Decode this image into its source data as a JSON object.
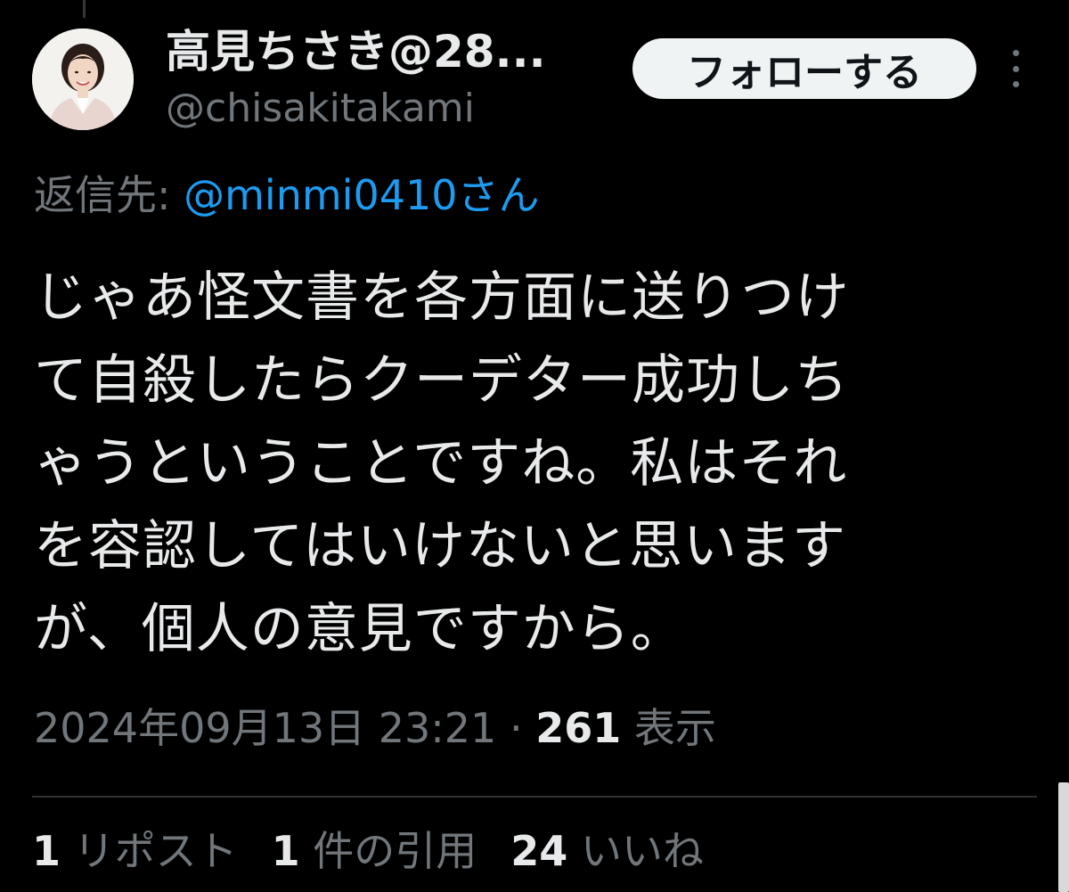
{
  "author": {
    "display_name": "高見ちさき@28...",
    "handle": "@chisakitakami"
  },
  "follow_button": {
    "label": "フォローする"
  },
  "reply_to": {
    "prefix": "返信先: ",
    "mention": "@minmi0410さん"
  },
  "tweet": {
    "lines": [
      "じゃあ怪文書を各方面に送りつけ",
      "て自殺したらクーデター成功しち",
      "ゃうということですね。私はそれ",
      "を容認してはいけないと思います",
      "が、個人の意見ですから。"
    ]
  },
  "meta": {
    "timestamp": "2024年09月13日 23:21",
    "separator": " · ",
    "views_count": "261",
    "views_label": " 表示"
  },
  "stats": {
    "reposts": {
      "count": "1",
      "label": " リポスト"
    },
    "quotes": {
      "count": "1",
      "label": " 件の引用"
    },
    "likes": {
      "count": "24",
      "label": " いいね"
    }
  },
  "icons": {
    "more": "more-dots-vertical-icon",
    "avatar": "profile-avatar"
  },
  "colors": {
    "background": "#000000",
    "text_primary": "#e7e9ea",
    "text_secondary": "#71767b",
    "link": "#1d9bf0",
    "button_bg": "#eff3f4",
    "divider": "#2f3336"
  }
}
